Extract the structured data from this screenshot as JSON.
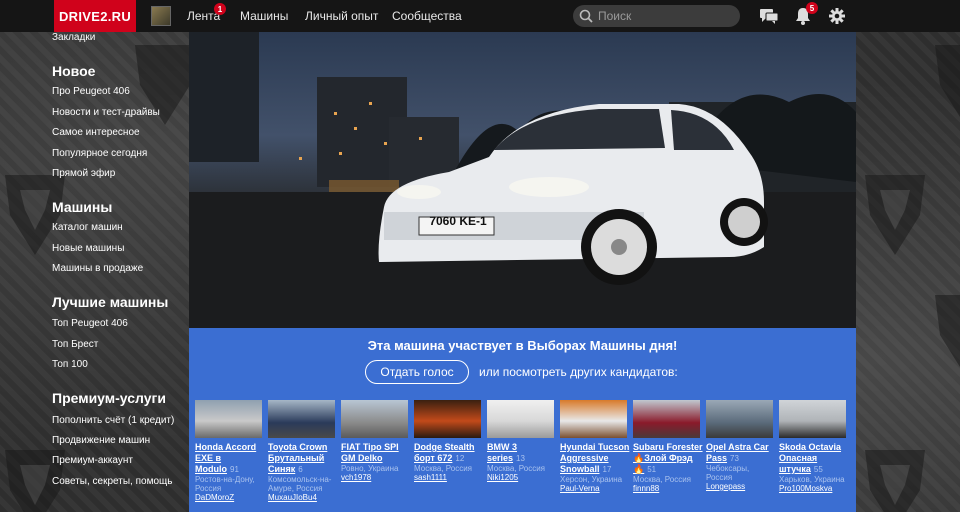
{
  "header": {
    "logo": "DRIVE2.RU",
    "nav": [
      {
        "label": "Лента",
        "badge": "1"
      },
      {
        "label": "Машины"
      },
      {
        "label": "Личный опыт"
      },
      {
        "label": "Сообщества"
      }
    ],
    "search_placeholder": "Поиск",
    "notifications_badge": "5",
    "icons": [
      "messages-icon",
      "bell-icon",
      "gear-icon"
    ]
  },
  "sidebar": {
    "top_item": "Закладки",
    "sections": [
      {
        "title": "Новое",
        "items": [
          "Про Peugeot 406",
          "Новости и тест-драйвы",
          "Самое интересное",
          "Популярное сегодня",
          "Прямой эфир"
        ]
      },
      {
        "title": "Машины",
        "items": [
          "Каталог машин",
          "Новые машины",
          "Машины в продаже"
        ]
      },
      {
        "title": "Лучшие машины",
        "items": [
          "Топ Peugeot 406",
          "Топ Брест",
          "Топ 100"
        ]
      },
      {
        "title": "Премиум-услуги",
        "items": [
          "Пополнить счёт (1 кредит)",
          "Продвижение машин",
          "Премиум-аккаунт",
          "Советы, секреты, помощь"
        ]
      }
    ]
  },
  "photo": {
    "plate": "7060 KE-1"
  },
  "election": {
    "title": "Эта машина участвует в Выборах Машины дня!",
    "vote_button": "Отдать голос",
    "other_text": "или посмотреть других кандидатов:",
    "candidates": [
      {
        "title": "Honda Accord EXE в Modulo",
        "count": "91",
        "location": "Ростов-на-Дону, Россия",
        "user": "DaDMoroZ",
        "color": "#c9c9c9"
      },
      {
        "title": "Toyota Crown Брутальный Синяк",
        "count": "6",
        "location": "Комсомольск-на-Амуре, Россия",
        "user": "MuxauJIoBu4",
        "color": "#2a3a5a"
      },
      {
        "title": "FIAT Tipo SPI GM Delko",
        "count": "",
        "location": "Ровно, Украина",
        "user": "vch1978",
        "color": "#8a8a8a"
      },
      {
        "title": "Dodge Stealth борт 672",
        "count": "12",
        "location": "Москва, Россия",
        "user": "sash1111",
        "color": "#c24a1a"
      },
      {
        "title": "BMW 3 series",
        "count": "13",
        "location": "Москва, Россия",
        "user": "Niki1205",
        "color": "#d8d8d8"
      },
      {
        "title": "Hyundai Tucson Aggressive Snowball",
        "count": "17",
        "location": "Херсон, Украина",
        "user": "Paul-Verna",
        "color": "#e8e8e8"
      },
      {
        "title": "Subaru Forester 🔥Злой Фрэд🔥",
        "count": "51",
        "location": "Москва, Россия",
        "user": "finnn88",
        "color": "#8a1a2a"
      },
      {
        "title": "Opel Astra Car Pass",
        "count": "73",
        "location": "Чебоксары, Россия",
        "user": "Longepass",
        "color": "#5a6a7a"
      },
      {
        "title": "Skoda Octavia Опасная штучка",
        "count": "55",
        "location": "Харьков, Украина",
        "user": "Pro100Moskva",
        "color": "#b0b4b8"
      }
    ]
  }
}
